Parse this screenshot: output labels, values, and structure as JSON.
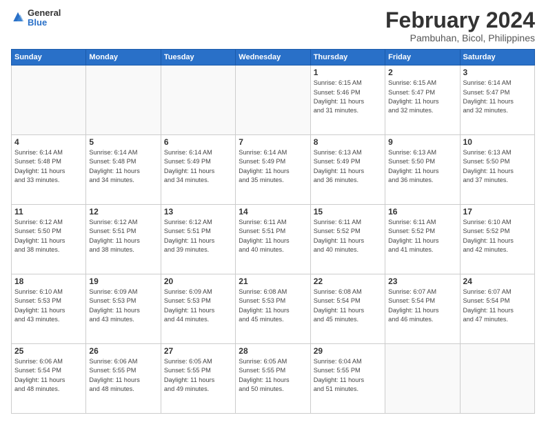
{
  "logo": {
    "general": "General",
    "blue": "Blue"
  },
  "title": "February 2024",
  "location": "Pambuhan, Bicol, Philippines",
  "days_of_week": [
    "Sunday",
    "Monday",
    "Tuesday",
    "Wednesday",
    "Thursday",
    "Friday",
    "Saturday"
  ],
  "weeks": [
    [
      {
        "day": "",
        "info": ""
      },
      {
        "day": "",
        "info": ""
      },
      {
        "day": "",
        "info": ""
      },
      {
        "day": "",
        "info": ""
      },
      {
        "day": "1",
        "info": "Sunrise: 6:15 AM\nSunset: 5:46 PM\nDaylight: 11 hours\nand 31 minutes."
      },
      {
        "day": "2",
        "info": "Sunrise: 6:15 AM\nSunset: 5:47 PM\nDaylight: 11 hours\nand 32 minutes."
      },
      {
        "day": "3",
        "info": "Sunrise: 6:14 AM\nSunset: 5:47 PM\nDaylight: 11 hours\nand 32 minutes."
      }
    ],
    [
      {
        "day": "4",
        "info": "Sunrise: 6:14 AM\nSunset: 5:48 PM\nDaylight: 11 hours\nand 33 minutes."
      },
      {
        "day": "5",
        "info": "Sunrise: 6:14 AM\nSunset: 5:48 PM\nDaylight: 11 hours\nand 34 minutes."
      },
      {
        "day": "6",
        "info": "Sunrise: 6:14 AM\nSunset: 5:49 PM\nDaylight: 11 hours\nand 34 minutes."
      },
      {
        "day": "7",
        "info": "Sunrise: 6:14 AM\nSunset: 5:49 PM\nDaylight: 11 hours\nand 35 minutes."
      },
      {
        "day": "8",
        "info": "Sunrise: 6:13 AM\nSunset: 5:49 PM\nDaylight: 11 hours\nand 36 minutes."
      },
      {
        "day": "9",
        "info": "Sunrise: 6:13 AM\nSunset: 5:50 PM\nDaylight: 11 hours\nand 36 minutes."
      },
      {
        "day": "10",
        "info": "Sunrise: 6:13 AM\nSunset: 5:50 PM\nDaylight: 11 hours\nand 37 minutes."
      }
    ],
    [
      {
        "day": "11",
        "info": "Sunrise: 6:12 AM\nSunset: 5:50 PM\nDaylight: 11 hours\nand 38 minutes."
      },
      {
        "day": "12",
        "info": "Sunrise: 6:12 AM\nSunset: 5:51 PM\nDaylight: 11 hours\nand 38 minutes."
      },
      {
        "day": "13",
        "info": "Sunrise: 6:12 AM\nSunset: 5:51 PM\nDaylight: 11 hours\nand 39 minutes."
      },
      {
        "day": "14",
        "info": "Sunrise: 6:11 AM\nSunset: 5:51 PM\nDaylight: 11 hours\nand 40 minutes."
      },
      {
        "day": "15",
        "info": "Sunrise: 6:11 AM\nSunset: 5:52 PM\nDaylight: 11 hours\nand 40 minutes."
      },
      {
        "day": "16",
        "info": "Sunrise: 6:11 AM\nSunset: 5:52 PM\nDaylight: 11 hours\nand 41 minutes."
      },
      {
        "day": "17",
        "info": "Sunrise: 6:10 AM\nSunset: 5:52 PM\nDaylight: 11 hours\nand 42 minutes."
      }
    ],
    [
      {
        "day": "18",
        "info": "Sunrise: 6:10 AM\nSunset: 5:53 PM\nDaylight: 11 hours\nand 43 minutes."
      },
      {
        "day": "19",
        "info": "Sunrise: 6:09 AM\nSunset: 5:53 PM\nDaylight: 11 hours\nand 43 minutes."
      },
      {
        "day": "20",
        "info": "Sunrise: 6:09 AM\nSunset: 5:53 PM\nDaylight: 11 hours\nand 44 minutes."
      },
      {
        "day": "21",
        "info": "Sunrise: 6:08 AM\nSunset: 5:53 PM\nDaylight: 11 hours\nand 45 minutes."
      },
      {
        "day": "22",
        "info": "Sunrise: 6:08 AM\nSunset: 5:54 PM\nDaylight: 11 hours\nand 45 minutes."
      },
      {
        "day": "23",
        "info": "Sunrise: 6:07 AM\nSunset: 5:54 PM\nDaylight: 11 hours\nand 46 minutes."
      },
      {
        "day": "24",
        "info": "Sunrise: 6:07 AM\nSunset: 5:54 PM\nDaylight: 11 hours\nand 47 minutes."
      }
    ],
    [
      {
        "day": "25",
        "info": "Sunrise: 6:06 AM\nSunset: 5:54 PM\nDaylight: 11 hours\nand 48 minutes."
      },
      {
        "day": "26",
        "info": "Sunrise: 6:06 AM\nSunset: 5:55 PM\nDaylight: 11 hours\nand 48 minutes."
      },
      {
        "day": "27",
        "info": "Sunrise: 6:05 AM\nSunset: 5:55 PM\nDaylight: 11 hours\nand 49 minutes."
      },
      {
        "day": "28",
        "info": "Sunrise: 6:05 AM\nSunset: 5:55 PM\nDaylight: 11 hours\nand 50 minutes."
      },
      {
        "day": "29",
        "info": "Sunrise: 6:04 AM\nSunset: 5:55 PM\nDaylight: 11 hours\nand 51 minutes."
      },
      {
        "day": "",
        "info": ""
      },
      {
        "day": "",
        "info": ""
      }
    ]
  ]
}
